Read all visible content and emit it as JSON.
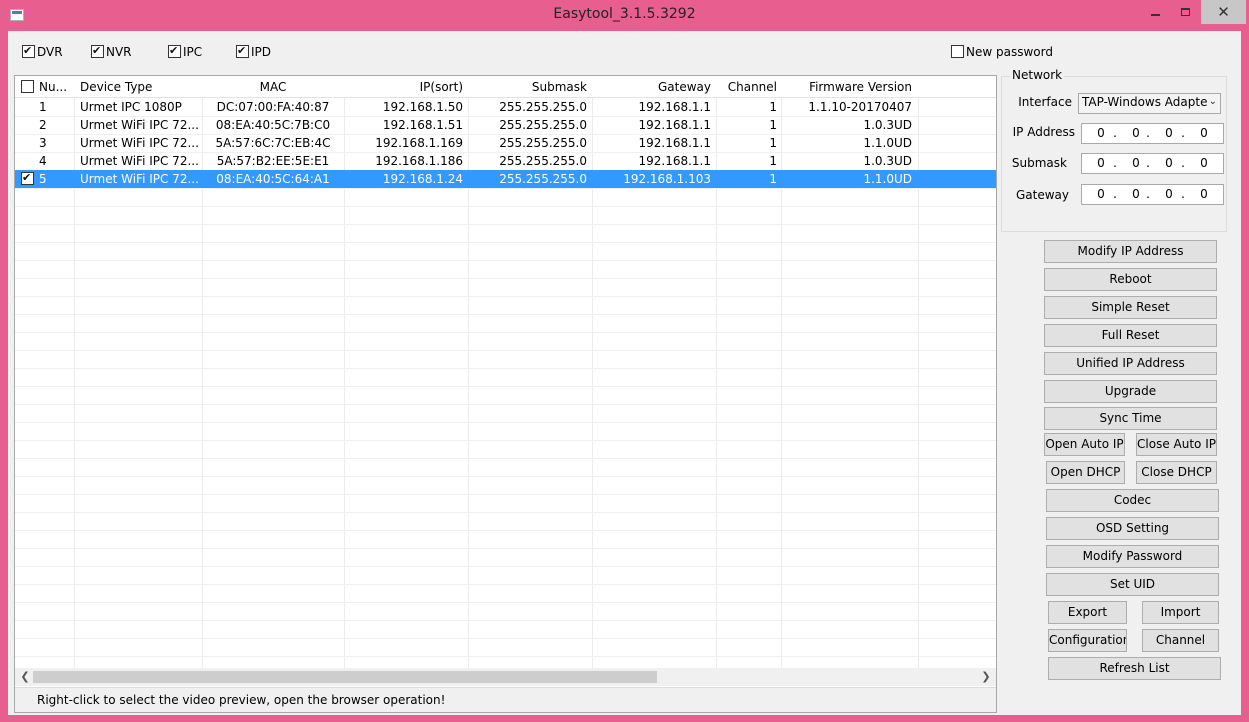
{
  "window": {
    "title": "Easytool_3.1.5.3292",
    "minimize_label": "",
    "close_label": "✕"
  },
  "filters": {
    "dvr": {
      "label": "DVR",
      "checked": true
    },
    "nvr": {
      "label": "NVR",
      "checked": true
    },
    "ipc": {
      "label": "IPC",
      "checked": true
    },
    "ipd": {
      "label": "IPD",
      "checked": true
    },
    "new_password": {
      "label": "New password",
      "checked": false
    }
  },
  "table": {
    "columns": [
      "Nu...",
      "Device Type",
      "MAC",
      "IP(sort)",
      "Submask",
      "Gateway",
      "Channel",
      "Firmware Version"
    ],
    "rows": [
      {
        "num": "1",
        "type": "Urmet IPC 1080P",
        "mac": "DC:07:00:FA:40:87",
        "ip": "192.168.1.50",
        "mask": "255.255.255.0",
        "gw": "192.168.1.1",
        "ch": "1",
        "fw": "1.1.10-20170407",
        "checked": false,
        "selected": false
      },
      {
        "num": "2",
        "type": "Urmet WiFi IPC 72...",
        "mac": "08:EA:40:5C:7B:C0",
        "ip": "192.168.1.51",
        "mask": "255.255.255.0",
        "gw": "192.168.1.1",
        "ch": "1",
        "fw": "1.0.3UD",
        "checked": false,
        "selected": false
      },
      {
        "num": "3",
        "type": "Urmet WiFi IPC 72...",
        "mac": "5A:57:6C:7C:EB:4C",
        "ip": "192.168.1.169",
        "mask": "255.255.255.0",
        "gw": "192.168.1.1",
        "ch": "1",
        "fw": "1.1.0UD",
        "checked": false,
        "selected": false
      },
      {
        "num": "4",
        "type": "Urmet WiFi IPC 72...",
        "mac": "5A:57:B2:EE:5E:E1",
        "ip": "192.168.1.186",
        "mask": "255.255.255.0",
        "gw": "192.168.1.1",
        "ch": "1",
        "fw": "1.0.3UD",
        "checked": false,
        "selected": false
      },
      {
        "num": "5",
        "type": "Urmet WiFi IPC 72...",
        "mac": "08:EA:40:5C:64:A1",
        "ip": "192.168.1.24",
        "mask": "255.255.255.0",
        "gw": "192.168.1.103",
        "ch": "1",
        "fw": "1.1.0UD",
        "checked": true,
        "selected": true
      }
    ]
  },
  "status_text": "Right-click to select the video preview, open the browser operation!",
  "network": {
    "title": "Network",
    "interface_label": "Interface",
    "interface_value": "TAP-Windows Adapte",
    "ip_label": "IP Address",
    "ip_value": [
      "0",
      "0",
      "0",
      "0"
    ],
    "submask_label": "Submask",
    "submask_value": [
      "0",
      "0",
      "0",
      "0"
    ],
    "gateway_label": "Gateway",
    "gateway_value": [
      "0",
      "0",
      "0",
      "0"
    ]
  },
  "buttons": {
    "modify_ip": "Modify IP Address",
    "reboot": "Reboot",
    "simple_reset": "Simple Reset",
    "full_reset": "Full Reset",
    "unified_ip": "Unified IP Address",
    "upgrade": "Upgrade",
    "sync_time": "Sync Time",
    "open_auto_ip": "Open Auto IP",
    "close_auto_ip": "Close Auto IP",
    "open_dhcp": "Open  DHCP",
    "close_dhcp": "Close DHCP",
    "codec": "Codec",
    "osd_setting": "OSD Setting",
    "modify_password": "Modify Password",
    "set_uid": "Set UID",
    "export": "Export",
    "import": "Import",
    "configuration": "Configuration",
    "channel": "Channel",
    "refresh_list": "Refresh List"
  }
}
